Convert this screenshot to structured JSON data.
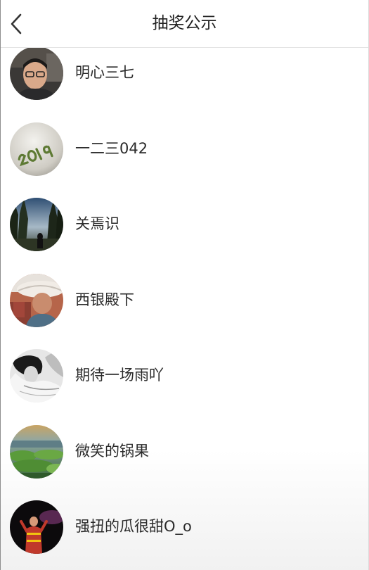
{
  "header": {
    "title": "抽奖公示",
    "back_icon": "chevron-left-icon"
  },
  "winners": [
    {
      "name": "明心三七",
      "avatar": "avatar-man-in-car"
    },
    {
      "name": "一二三042",
      "avatar": "avatar-2019-text"
    },
    {
      "name": "关焉识",
      "avatar": "avatar-forest-silhouette"
    },
    {
      "name": "西银殿下",
      "avatar": "avatar-person-in-hat"
    },
    {
      "name": "期待一场雨吖",
      "avatar": "avatar-bw-woman"
    },
    {
      "name": "微笑的锅果",
      "avatar": "avatar-green-landscape"
    },
    {
      "name": "强扭的瓜很甜O_o",
      "avatar": "avatar-performer-stage"
    }
  ]
}
